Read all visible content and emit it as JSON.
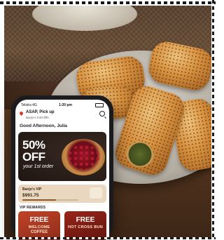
{
  "app": {
    "status_bar": {
      "carrier": "Telstra 4G",
      "time": "1:20 pm"
    },
    "location": {
      "pickup_label": "ASAP, Pick up",
      "store_name": "Banjo's Kirkcliffe"
    },
    "greeting": "Good Afternoon, Julia",
    "promo": {
      "headline_line1": "50%",
      "headline_line2": "OFF",
      "subtext": "your 1st order"
    },
    "vip": {
      "label": "Banjo's VIP",
      "amount": "$991.75",
      "progress": 0.6
    },
    "rewards": {
      "section_title": "VIP REWARDS",
      "cards": [
        {
          "free": "FREE",
          "line1": "WELCOME",
          "line2": "COFFEE"
        },
        {
          "free": "FREE",
          "line1": "HOT CROSS BUN",
          "line2": ""
        }
      ]
    }
  },
  "colors": {
    "brand_red": "#c24328",
    "vip_bg": "#e9d8bf"
  },
  "icons": {
    "location": "location-pin-icon",
    "search": "search-icon"
  }
}
